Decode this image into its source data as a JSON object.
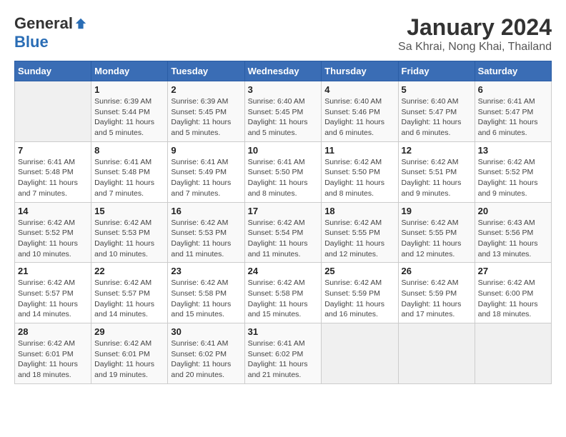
{
  "header": {
    "logo_general": "General",
    "logo_blue": "Blue",
    "month": "January 2024",
    "location": "Sa Khrai, Nong Khai, Thailand"
  },
  "days_of_week": [
    "Sunday",
    "Monday",
    "Tuesday",
    "Wednesday",
    "Thursday",
    "Friday",
    "Saturday"
  ],
  "weeks": [
    [
      {
        "day": "",
        "sunrise": "",
        "sunset": "",
        "daylight": ""
      },
      {
        "day": "1",
        "sunrise": "Sunrise: 6:39 AM",
        "sunset": "Sunset: 5:44 PM",
        "daylight": "Daylight: 11 hours and 5 minutes."
      },
      {
        "day": "2",
        "sunrise": "Sunrise: 6:39 AM",
        "sunset": "Sunset: 5:45 PM",
        "daylight": "Daylight: 11 hours and 5 minutes."
      },
      {
        "day": "3",
        "sunrise": "Sunrise: 6:40 AM",
        "sunset": "Sunset: 5:45 PM",
        "daylight": "Daylight: 11 hours and 5 minutes."
      },
      {
        "day": "4",
        "sunrise": "Sunrise: 6:40 AM",
        "sunset": "Sunset: 5:46 PM",
        "daylight": "Daylight: 11 hours and 6 minutes."
      },
      {
        "day": "5",
        "sunrise": "Sunrise: 6:40 AM",
        "sunset": "Sunset: 5:47 PM",
        "daylight": "Daylight: 11 hours and 6 minutes."
      },
      {
        "day": "6",
        "sunrise": "Sunrise: 6:41 AM",
        "sunset": "Sunset: 5:47 PM",
        "daylight": "Daylight: 11 hours and 6 minutes."
      }
    ],
    [
      {
        "day": "7",
        "sunrise": "Sunrise: 6:41 AM",
        "sunset": "Sunset: 5:48 PM",
        "daylight": "Daylight: 11 hours and 7 minutes."
      },
      {
        "day": "8",
        "sunrise": "Sunrise: 6:41 AM",
        "sunset": "Sunset: 5:48 PM",
        "daylight": "Daylight: 11 hours and 7 minutes."
      },
      {
        "day": "9",
        "sunrise": "Sunrise: 6:41 AM",
        "sunset": "Sunset: 5:49 PM",
        "daylight": "Daylight: 11 hours and 7 minutes."
      },
      {
        "day": "10",
        "sunrise": "Sunrise: 6:41 AM",
        "sunset": "Sunset: 5:50 PM",
        "daylight": "Daylight: 11 hours and 8 minutes."
      },
      {
        "day": "11",
        "sunrise": "Sunrise: 6:42 AM",
        "sunset": "Sunset: 5:50 PM",
        "daylight": "Daylight: 11 hours and 8 minutes."
      },
      {
        "day": "12",
        "sunrise": "Sunrise: 6:42 AM",
        "sunset": "Sunset: 5:51 PM",
        "daylight": "Daylight: 11 hours and 9 minutes."
      },
      {
        "day": "13",
        "sunrise": "Sunrise: 6:42 AM",
        "sunset": "Sunset: 5:52 PM",
        "daylight": "Daylight: 11 hours and 9 minutes."
      }
    ],
    [
      {
        "day": "14",
        "sunrise": "Sunrise: 6:42 AM",
        "sunset": "Sunset: 5:52 PM",
        "daylight": "Daylight: 11 hours and 10 minutes."
      },
      {
        "day": "15",
        "sunrise": "Sunrise: 6:42 AM",
        "sunset": "Sunset: 5:53 PM",
        "daylight": "Daylight: 11 hours and 10 minutes."
      },
      {
        "day": "16",
        "sunrise": "Sunrise: 6:42 AM",
        "sunset": "Sunset: 5:53 PM",
        "daylight": "Daylight: 11 hours and 11 minutes."
      },
      {
        "day": "17",
        "sunrise": "Sunrise: 6:42 AM",
        "sunset": "Sunset: 5:54 PM",
        "daylight": "Daylight: 11 hours and 11 minutes."
      },
      {
        "day": "18",
        "sunrise": "Sunrise: 6:42 AM",
        "sunset": "Sunset: 5:55 PM",
        "daylight": "Daylight: 11 hours and 12 minutes."
      },
      {
        "day": "19",
        "sunrise": "Sunrise: 6:42 AM",
        "sunset": "Sunset: 5:55 PM",
        "daylight": "Daylight: 11 hours and 12 minutes."
      },
      {
        "day": "20",
        "sunrise": "Sunrise: 6:43 AM",
        "sunset": "Sunset: 5:56 PM",
        "daylight": "Daylight: 11 hours and 13 minutes."
      }
    ],
    [
      {
        "day": "21",
        "sunrise": "Sunrise: 6:42 AM",
        "sunset": "Sunset: 5:57 PM",
        "daylight": "Daylight: 11 hours and 14 minutes."
      },
      {
        "day": "22",
        "sunrise": "Sunrise: 6:42 AM",
        "sunset": "Sunset: 5:57 PM",
        "daylight": "Daylight: 11 hours and 14 minutes."
      },
      {
        "day": "23",
        "sunrise": "Sunrise: 6:42 AM",
        "sunset": "Sunset: 5:58 PM",
        "daylight": "Daylight: 11 hours and 15 minutes."
      },
      {
        "day": "24",
        "sunrise": "Sunrise: 6:42 AM",
        "sunset": "Sunset: 5:58 PM",
        "daylight": "Daylight: 11 hours and 15 minutes."
      },
      {
        "day": "25",
        "sunrise": "Sunrise: 6:42 AM",
        "sunset": "Sunset: 5:59 PM",
        "daylight": "Daylight: 11 hours and 16 minutes."
      },
      {
        "day": "26",
        "sunrise": "Sunrise: 6:42 AM",
        "sunset": "Sunset: 5:59 PM",
        "daylight": "Daylight: 11 hours and 17 minutes."
      },
      {
        "day": "27",
        "sunrise": "Sunrise: 6:42 AM",
        "sunset": "Sunset: 6:00 PM",
        "daylight": "Daylight: 11 hours and 18 minutes."
      }
    ],
    [
      {
        "day": "28",
        "sunrise": "Sunrise: 6:42 AM",
        "sunset": "Sunset: 6:01 PM",
        "daylight": "Daylight: 11 hours and 18 minutes."
      },
      {
        "day": "29",
        "sunrise": "Sunrise: 6:42 AM",
        "sunset": "Sunset: 6:01 PM",
        "daylight": "Daylight: 11 hours and 19 minutes."
      },
      {
        "day": "30",
        "sunrise": "Sunrise: 6:41 AM",
        "sunset": "Sunset: 6:02 PM",
        "daylight": "Daylight: 11 hours and 20 minutes."
      },
      {
        "day": "31",
        "sunrise": "Sunrise: 6:41 AM",
        "sunset": "Sunset: 6:02 PM",
        "daylight": "Daylight: 11 hours and 21 minutes."
      },
      {
        "day": "",
        "sunrise": "",
        "sunset": "",
        "daylight": ""
      },
      {
        "day": "",
        "sunrise": "",
        "sunset": "",
        "daylight": ""
      },
      {
        "day": "",
        "sunrise": "",
        "sunset": "",
        "daylight": ""
      }
    ]
  ]
}
